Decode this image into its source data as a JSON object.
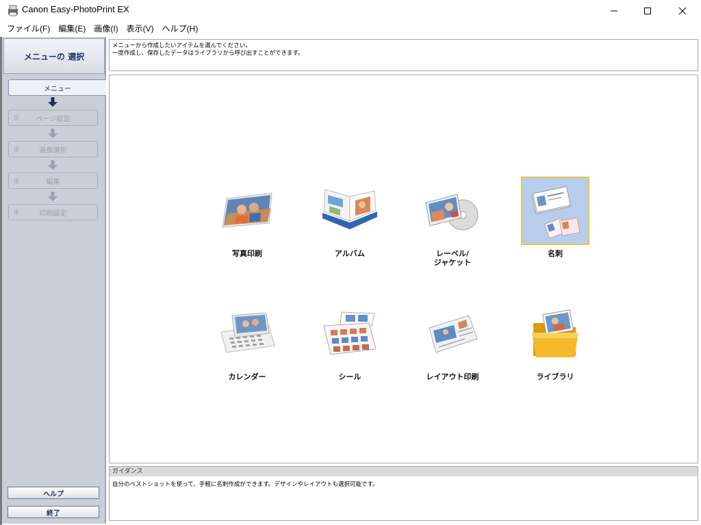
{
  "window": {
    "title": "Canon Easy-PhotoPrint EX"
  },
  "menubar": {
    "items": [
      "ファイル(F)",
      "編集(E)",
      "画像(I)",
      "表示(V)",
      "ヘルプ(H)"
    ]
  },
  "sidebar": {
    "title": "メニューの 選択",
    "steps": [
      {
        "num": "",
        "label": "メニュー"
      },
      {
        "num": "①",
        "label": "ページ設定"
      },
      {
        "num": "②",
        "label": "画像選択"
      },
      {
        "num": "③",
        "label": "編集"
      },
      {
        "num": "④",
        "label": "印刷設定"
      }
    ],
    "help_label": "ヘルプ",
    "exit_label": "終了"
  },
  "instructions": {
    "line1": "メニューから作成したいアイテムを選んでください。",
    "line2": "一度作成し、保存したデータはライブラリから呼び出すことができます。"
  },
  "menu_tiles": [
    {
      "label": "写真印刷",
      "icon": "photo-print-icon",
      "selected": false
    },
    {
      "label": "アルバム",
      "icon": "album-icon",
      "selected": false
    },
    {
      "label": "レーベル/\nジャケット",
      "icon": "label-jacket-icon",
      "selected": false
    },
    {
      "label": "名刺",
      "icon": "business-card-icon",
      "selected": true
    },
    {
      "label": "カレンダー",
      "icon": "calendar-icon",
      "selected": false
    },
    {
      "label": "シール",
      "icon": "sticker-icon",
      "selected": false
    },
    {
      "label": "レイアウト印刷",
      "icon": "layout-print-icon",
      "selected": false
    },
    {
      "label": "ライブラリ",
      "icon": "library-folder-icon",
      "selected": false
    }
  ],
  "guidance": {
    "header": "ガイダンス",
    "text": "自分のベストショットを使って、手軽に名刺作成ができます。デザインやレイアウトも選択可能です。"
  },
  "colors": {
    "sidebar_bg": "#c9cfd8",
    "selected_bg": "#b7cdeb",
    "selected_border": "#e6c44a",
    "title_text": "#1b2f5e"
  }
}
